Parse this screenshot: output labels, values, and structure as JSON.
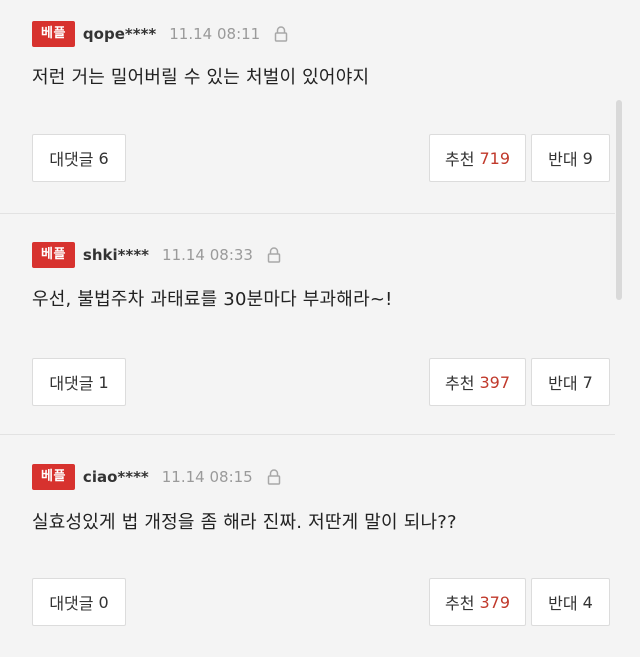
{
  "badge_label": "베플",
  "comments": [
    {
      "user": "qope****",
      "time": "11.14 08:11",
      "text": "저런 거는 밀어버릴 수 있는 처벌이 있어야지",
      "reply_label": "대댓글",
      "reply_count": "6",
      "up_label": "추천",
      "up_count": "719",
      "down_label": "반대",
      "down_count": "9"
    },
    {
      "user": "shki****",
      "time": "11.14 08:33",
      "text": "우선, 불법주차 과태료를 30분마다 부과해라~!",
      "reply_label": "대댓글",
      "reply_count": "1",
      "up_label": "추천",
      "up_count": "397",
      "down_label": "반대",
      "down_count": "7"
    },
    {
      "user": "ciao****",
      "time": "11.14 08:15",
      "text": "실효성있게 법 개정을 좀 해라 진짜. 저딴게 말이 되나??",
      "reply_label": "대댓글",
      "reply_count": "0",
      "up_label": "추천",
      "up_count": "379",
      "down_label": "반대",
      "down_count": "4"
    }
  ],
  "colors": {
    "badge": "#d7322e",
    "up_count": "#c0392b",
    "background": "#f4f4f4"
  },
  "icons": {
    "lock": "lock-icon"
  }
}
